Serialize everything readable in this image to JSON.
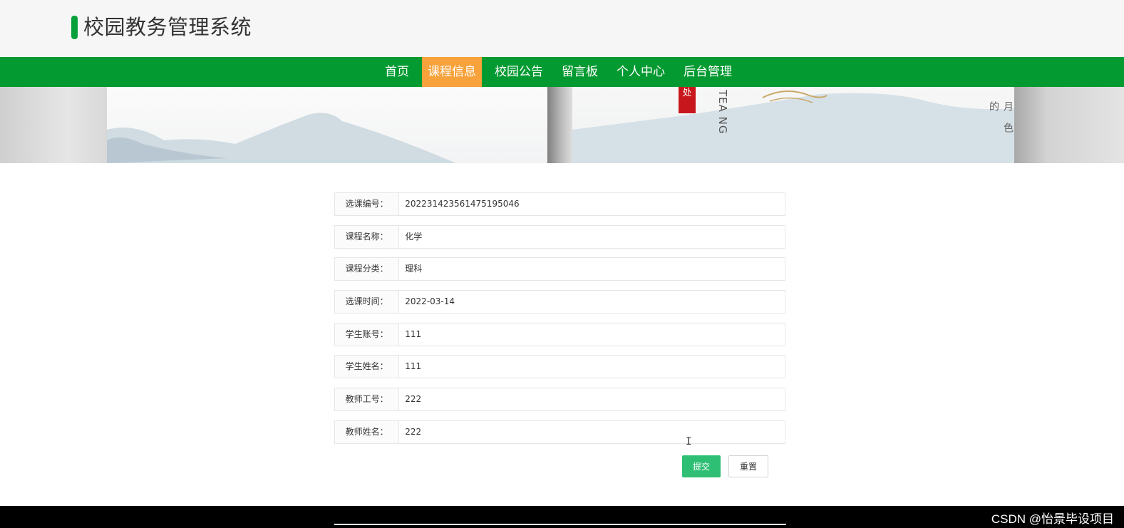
{
  "header": {
    "title": "校园教务管理系统"
  },
  "nav": {
    "items": [
      {
        "label": "首页",
        "active": false
      },
      {
        "label": "课程信息",
        "active": true
      },
      {
        "label": "校园公告",
        "active": false
      },
      {
        "label": "留言板",
        "active": false
      },
      {
        "label": "个人中心",
        "active": false
      },
      {
        "label": "后台管理",
        "active": false
      }
    ]
  },
  "banner": {
    "seal_text": "处",
    "side_text": "TEA NG",
    "vertical_chars": "月色的"
  },
  "form": {
    "fields": [
      {
        "label": "选课编号：",
        "value": "2022314235614751950​46"
      },
      {
        "label": "课程名称：",
        "value": "化学"
      },
      {
        "label": "课程分类：",
        "value": "理科"
      },
      {
        "label": "选课时间：",
        "value": "2022-03-14"
      },
      {
        "label": "学生账号：",
        "value": "111"
      },
      {
        "label": "学生姓名：",
        "value": "111"
      },
      {
        "label": "教师工号：",
        "value": "222"
      },
      {
        "label": "教师姓名：",
        "value": "222"
      }
    ],
    "submit_label": "提交",
    "reset_label": "重置"
  },
  "footer": {
    "watermark": "CSDN @怡景毕设项目"
  },
  "colors": {
    "nav_bg": "#049a32",
    "nav_active": "#f7a23a",
    "logo_bar": "#07a03a",
    "submit_bg": "#2ebf75"
  }
}
